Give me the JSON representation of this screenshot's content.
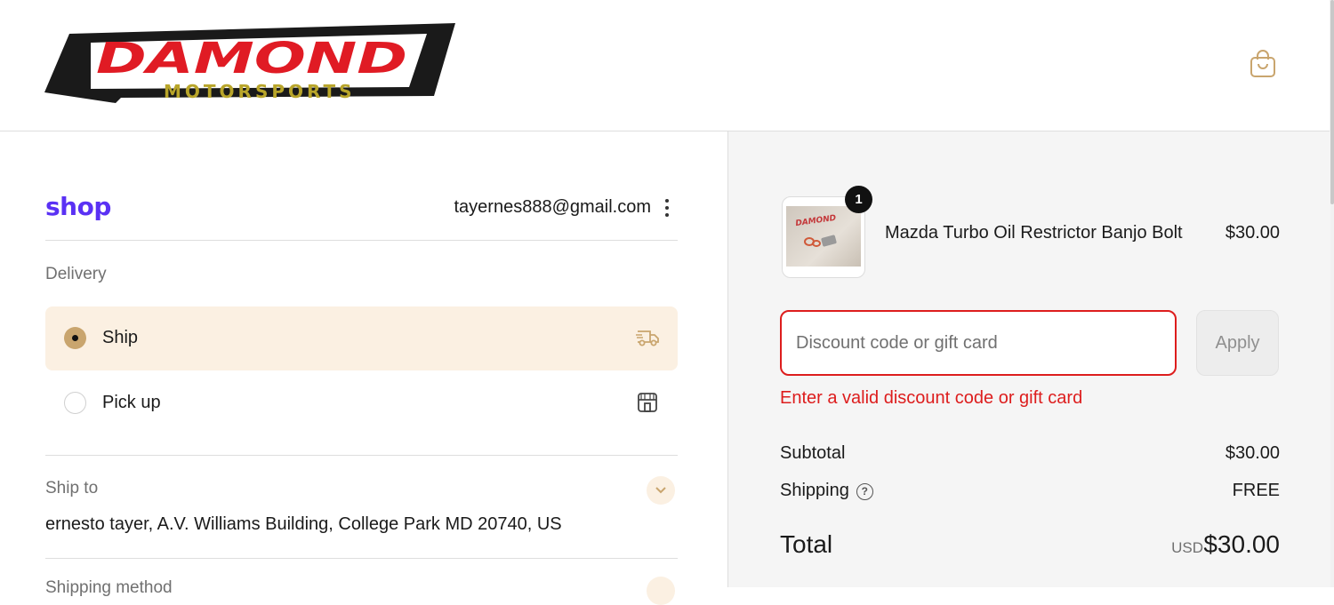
{
  "brand": {
    "logo_word": "DAMOND",
    "logo_sub": "MOTORSPORTS",
    "colors": {
      "red": "#e01b24",
      "gold": "#b8a52a",
      "black": "#1a1a1a"
    }
  },
  "header": {
    "cart_icon": "shopping-bag-icon"
  },
  "shop_pay": {
    "logo": "shop",
    "email": "tayernes888@gmail.com"
  },
  "delivery": {
    "label": "Delivery",
    "options": [
      {
        "label": "Ship",
        "selected": true,
        "icon": "truck-icon"
      },
      {
        "label": "Pick up",
        "selected": false,
        "icon": "store-icon"
      }
    ]
  },
  "ship_to": {
    "label": "Ship to",
    "address": "ernesto tayer, A.V. Williams Building, College Park MD 20740, US"
  },
  "shipping_method": {
    "label": "Shipping method"
  },
  "summary": {
    "item": {
      "name": "Mazda Turbo Oil Restrictor Banjo Bolt",
      "price": "$30.00",
      "quantity": "1"
    },
    "discount": {
      "placeholder": "Discount code or gift card",
      "apply_label": "Apply",
      "error": "Enter a valid discount code or gift card"
    },
    "subtotal_label": "Subtotal",
    "subtotal_value": "$30.00",
    "shipping_label": "Shipping",
    "shipping_value": "FREE",
    "total_label": "Total",
    "currency": "USD",
    "total_value": "$30.00"
  },
  "accent_color": "#c9a56e",
  "error_color": "#dd1d1d"
}
